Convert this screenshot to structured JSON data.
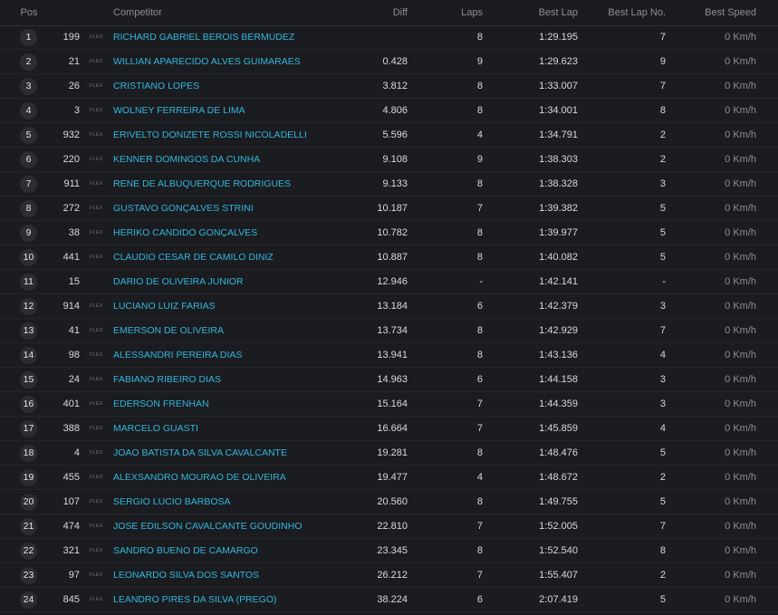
{
  "columns": {
    "pos": "Pos",
    "competitor": "Competitor",
    "diff": "Diff",
    "laps": "Laps",
    "best_lap": "Best Lap",
    "best_lap_no": "Best Lap No.",
    "best_speed": "Best Speed"
  },
  "rows": [
    {
      "pos": "1",
      "num": "199",
      "flex": "FLEX",
      "name": "RICHARD GABRIEL BEROIS BERMUDEZ",
      "diff": "",
      "laps": "8",
      "best_lap": "1:29.195",
      "best_lap_no": "7",
      "speed": "0 Km/h"
    },
    {
      "pos": "2",
      "num": "21",
      "flex": "FLEX",
      "name": "WILLIAN APARECIDO ALVES GUIMARAES",
      "diff": "0.428",
      "laps": "9",
      "best_lap": "1:29.623",
      "best_lap_no": "9",
      "speed": "0 Km/h"
    },
    {
      "pos": "3",
      "num": "26",
      "flex": "FLEX",
      "name": "CRISTIANO LOPES",
      "diff": "3.812",
      "laps": "8",
      "best_lap": "1:33.007",
      "best_lap_no": "7",
      "speed": "0 Km/h"
    },
    {
      "pos": "4",
      "num": "3",
      "flex": "FLEX",
      "name": "WOLNEY FERREIRA DE LIMA",
      "diff": "4.806",
      "laps": "8",
      "best_lap": "1:34.001",
      "best_lap_no": "8",
      "speed": "0 Km/h"
    },
    {
      "pos": "5",
      "num": "932",
      "flex": "FLEX",
      "name": "ERIVELTO DONIZETE ROSSI NICOLADELLI",
      "diff": "5.596",
      "laps": "4",
      "best_lap": "1:34.791",
      "best_lap_no": "2",
      "speed": "0 Km/h"
    },
    {
      "pos": "6",
      "num": "220",
      "flex": "FLEX",
      "name": "KENNER DOMINGOS DA CUNHA",
      "diff": "9.108",
      "laps": "9",
      "best_lap": "1:38.303",
      "best_lap_no": "2",
      "speed": "0 Km/h"
    },
    {
      "pos": "7",
      "num": "911",
      "flex": "FLEX",
      "name": "RENE DE ALBUQUERQUE RODRIGUES",
      "diff": "9.133",
      "laps": "8",
      "best_lap": "1:38.328",
      "best_lap_no": "3",
      "speed": "0 Km/h"
    },
    {
      "pos": "8",
      "num": "272",
      "flex": "FLEX",
      "name": "GUSTAVO GONÇALVES STRINI",
      "diff": "10.187",
      "laps": "7",
      "best_lap": "1:39.382",
      "best_lap_no": "5",
      "speed": "0 Km/h"
    },
    {
      "pos": "9",
      "num": "38",
      "flex": "FLEX",
      "name": "HERIKO CANDIDO GONÇALVES",
      "diff": "10.782",
      "laps": "8",
      "best_lap": "1:39.977",
      "best_lap_no": "5",
      "speed": "0 Km/h"
    },
    {
      "pos": "10",
      "num": "441",
      "flex": "FLEX",
      "name": "CLAUDIO CESAR DE CAMILO DINIZ",
      "diff": "10.887",
      "laps": "8",
      "best_lap": "1:40.082",
      "best_lap_no": "5",
      "speed": "0 Km/h"
    },
    {
      "pos": "11",
      "num": "15",
      "flex": "",
      "name": "DARIO DE OLIVEIRA JUNIOR",
      "diff": "12.946",
      "laps": "-",
      "best_lap": "1:42.141",
      "best_lap_no": "-",
      "speed": "0 Km/h"
    },
    {
      "pos": "12",
      "num": "914",
      "flex": "FLEX",
      "name": "LUCIANO LUIZ FARIAS",
      "diff": "13.184",
      "laps": "6",
      "best_lap": "1:42.379",
      "best_lap_no": "3",
      "speed": "0 Km/h"
    },
    {
      "pos": "13",
      "num": "41",
      "flex": "FLEX",
      "name": "EMERSON DE OLIVEIRA",
      "diff": "13.734",
      "laps": "8",
      "best_lap": "1:42.929",
      "best_lap_no": "7",
      "speed": "0 Km/h"
    },
    {
      "pos": "14",
      "num": "98",
      "flex": "FLEX",
      "name": "ALESSANDRI PEREIRA DIAS",
      "diff": "13.941",
      "laps": "8",
      "best_lap": "1:43.136",
      "best_lap_no": "4",
      "speed": "0 Km/h"
    },
    {
      "pos": "15",
      "num": "24",
      "flex": "FLEX",
      "name": "FABIANO RIBEIRO DIAS",
      "diff": "14.963",
      "laps": "6",
      "best_lap": "1:44.158",
      "best_lap_no": "3",
      "speed": "0 Km/h"
    },
    {
      "pos": "16",
      "num": "401",
      "flex": "FLEX",
      "name": "EDERSON FRENHAN",
      "diff": "15.164",
      "laps": "7",
      "best_lap": "1:44.359",
      "best_lap_no": "3",
      "speed": "0 Km/h"
    },
    {
      "pos": "17",
      "num": "388",
      "flex": "FLEX",
      "name": "MARCELO GUASTI",
      "diff": "16.664",
      "laps": "7",
      "best_lap": "1:45.859",
      "best_lap_no": "4",
      "speed": "0 Km/h"
    },
    {
      "pos": "18",
      "num": "4",
      "flex": "FLEX",
      "name": "JOAO BATISTA DA SILVA CAVALCANTE",
      "diff": "19.281",
      "laps": "8",
      "best_lap": "1:48.476",
      "best_lap_no": "5",
      "speed": "0 Km/h"
    },
    {
      "pos": "19",
      "num": "455",
      "flex": "FLEX",
      "name": "ALEXSANDRO MOURAO DE OLIVEIRA",
      "diff": "19.477",
      "laps": "4",
      "best_lap": "1:48.672",
      "best_lap_no": "2",
      "speed": "0 Km/h"
    },
    {
      "pos": "20",
      "num": "107",
      "flex": "FLEX",
      "name": "SERGIO LUCIO BARBOSA",
      "diff": "20.560",
      "laps": "8",
      "best_lap": "1:49.755",
      "best_lap_no": "5",
      "speed": "0 Km/h"
    },
    {
      "pos": "21",
      "num": "474",
      "flex": "FLEX",
      "name": "JOSE EDILSON CAVALCANTE GOUDINHO",
      "diff": "22.810",
      "laps": "7",
      "best_lap": "1:52.005",
      "best_lap_no": "7",
      "speed": "0 Km/h"
    },
    {
      "pos": "22",
      "num": "321",
      "flex": "FLEX",
      "name": "SANDRO BUENO DE CAMARGO",
      "diff": "23.345",
      "laps": "8",
      "best_lap": "1:52.540",
      "best_lap_no": "8",
      "speed": "0 Km/h"
    },
    {
      "pos": "23",
      "num": "97",
      "flex": "FLEX",
      "name": "LEONARDO SILVA DOS SANTOS",
      "diff": "26.212",
      "laps": "7",
      "best_lap": "1:55.407",
      "best_lap_no": "2",
      "speed": "0 Km/h"
    },
    {
      "pos": "24",
      "num": "845",
      "flex": "FLEX",
      "name": "LEANDRO PIRES DA SILVA (PREGO)",
      "diff": "38.224",
      "laps": "6",
      "best_lap": "2:07.419",
      "best_lap_no": "5",
      "speed": "0 Km/h"
    }
  ],
  "colors": {
    "background": "#1b1c20",
    "competitor_link": "#32b6dc",
    "header_text": "#8a8e94",
    "badge": "#2b2d33"
  }
}
